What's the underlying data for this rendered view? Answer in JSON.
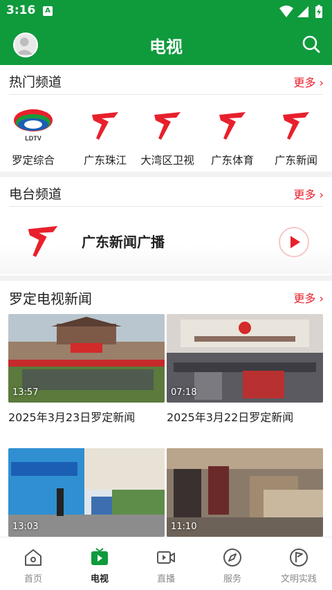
{
  "status_bar": {
    "time": "3:16",
    "sim_badge": "A"
  },
  "app_bar": {
    "title": "电视"
  },
  "hot_channels": {
    "section_label": "热门频道",
    "more_label": "更多",
    "items": [
      {
        "name": "罗定综合",
        "logo_text": "LDTV",
        "logo": "ldtv-logo"
      },
      {
        "name": "广东珠江",
        "logo": "gdtv-logo"
      },
      {
        "name": "大湾区卫视",
        "logo": "gdtv-logo"
      },
      {
        "name": "广东体育",
        "logo": "gdtv-logo"
      },
      {
        "name": "广东新闻",
        "logo": "gdtv-logo"
      }
    ]
  },
  "radio_channels": {
    "section_label": "电台频道",
    "more_label": "更多",
    "item": {
      "name": "广东新闻广播",
      "logo": "gdtv-logo"
    }
  },
  "tv_news": {
    "section_label": "罗定电视新闻",
    "more_label": "更多",
    "items": [
      {
        "duration": "13:57",
        "title": "2025年3月23日罗定新闻"
      },
      {
        "duration": "07:18",
        "title": "2025年3月22日罗定新闻"
      },
      {
        "duration": "13:03",
        "title": ""
      },
      {
        "duration": "11:10",
        "title": ""
      }
    ]
  },
  "bottom_nav": {
    "items": [
      {
        "label": "首页",
        "icon": "home-icon"
      },
      {
        "label": "电视",
        "icon": "tv-icon",
        "active": true
      },
      {
        "label": "直播",
        "icon": "live-icon"
      },
      {
        "label": "服务",
        "icon": "compass-icon"
      },
      {
        "label": "文明实践",
        "icon": "flag-icon"
      }
    ]
  },
  "colors": {
    "brand_green": "#0f9a3c",
    "accent_red": "#e8202c"
  }
}
